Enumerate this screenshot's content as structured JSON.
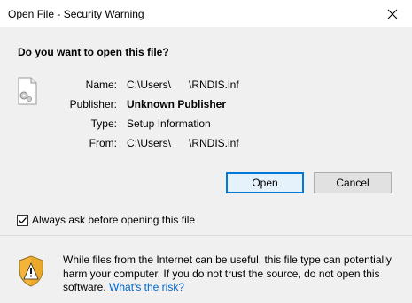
{
  "window": {
    "title": "Open File - Security Warning",
    "close_glyph": "✕"
  },
  "dialog": {
    "question": "Do you want to open this file?",
    "name_label": "Name:",
    "name_value": "C:\\Users\\      \\RNDIS.inf",
    "publisher_label": "Publisher:",
    "publisher_value": "Unknown Publisher",
    "type_label": "Type:",
    "type_value": "Setup Information",
    "from_label": "From:",
    "from_value": "C:\\Users\\      \\RNDIS.inf",
    "open_label": "Open",
    "cancel_label": "Cancel",
    "checkbox_label": "Always ask before opening this file",
    "checkbox_checked": true,
    "warning_text": "While files from the Internet can be useful, this file type can potentially harm your computer. If you do not trust the source, do not open this software. ",
    "risk_link": "What's the risk?"
  },
  "colors": {
    "accent": "#0078d7",
    "link": "#0066cc",
    "panel": "#f0f0f0"
  },
  "icons": [
    "close-icon",
    "file-icon",
    "checkmark-icon",
    "shield-warning-icon"
  ]
}
